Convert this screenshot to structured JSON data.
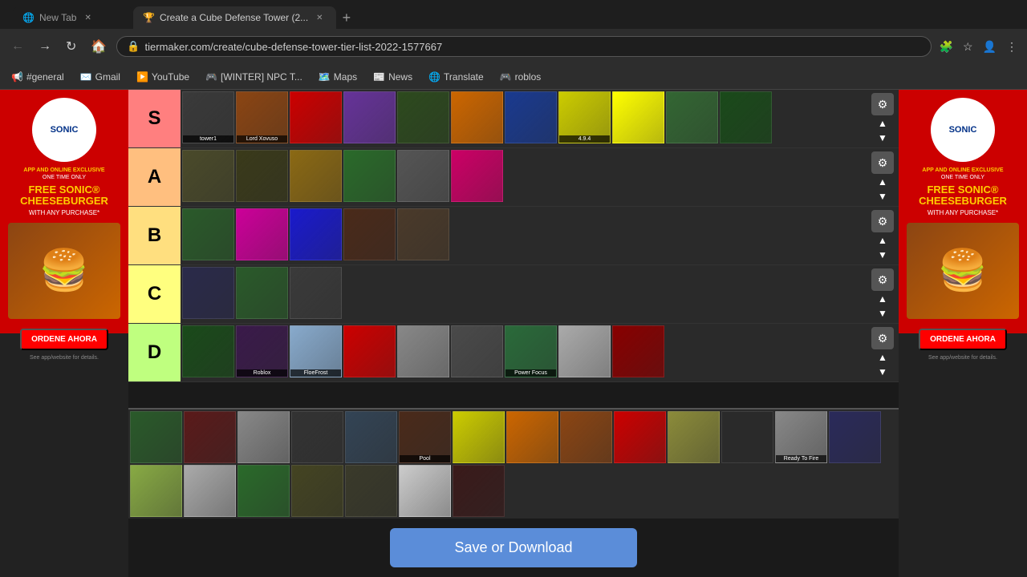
{
  "browser": {
    "tabs": [
      {
        "id": "newtab",
        "label": "New Tab",
        "active": false,
        "favicon": "🌐"
      },
      {
        "id": "tiermaker",
        "label": "Create a Cube Defense Tower (2...",
        "active": true,
        "favicon": "🏆"
      }
    ],
    "url": "tiermaker.com/create/cube-defense-tower-tier-list-2022-1577667",
    "bookmarks": [
      {
        "label": "#general",
        "icon": "📢"
      },
      {
        "label": "Gmail",
        "icon": "✉️"
      },
      {
        "label": "YouTube",
        "icon": "▶️"
      },
      {
        "label": "[WINTER] NPC T...",
        "icon": "🎮"
      },
      {
        "label": "Maps",
        "icon": "🗺️"
      },
      {
        "label": "News",
        "icon": "📰"
      },
      {
        "label": "Translate",
        "icon": "🌐"
      },
      {
        "label": "roblos",
        "icon": "🎮"
      }
    ]
  },
  "tiers": [
    {
      "id": "s",
      "label": "S",
      "color": "#ff7f7f",
      "items": [
        {
          "bg": "#3a3a3a",
          "label": "tower1"
        },
        {
          "bg": "#8B4513",
          "label": "Lord Xovuso"
        },
        {
          "bg": "#cc0000",
          "label": ""
        },
        {
          "bg": "#663399",
          "label": ""
        },
        {
          "bg": "#2d4a1e",
          "label": ""
        },
        {
          "bg": "#cc6600",
          "label": ""
        },
        {
          "bg": "#1a3a8f",
          "label": ""
        },
        {
          "bg": "#cccc00",
          "label": "4.9.4"
        },
        {
          "bg": "#ffff00",
          "label": ""
        },
        {
          "bg": "#336633",
          "label": ""
        },
        {
          "bg": "#1a4a1a",
          "label": ""
        }
      ]
    },
    {
      "id": "a",
      "label": "A",
      "color": "#ffbf7f",
      "items": [
        {
          "bg": "#4a4a2a",
          "label": ""
        },
        {
          "bg": "#3a3a1a",
          "label": ""
        },
        {
          "bg": "#8B6914",
          "label": ""
        },
        {
          "bg": "#2a6a2a",
          "label": ""
        },
        {
          "bg": "#555555",
          "label": ""
        },
        {
          "bg": "#cc0066",
          "label": ""
        }
      ]
    },
    {
      "id": "b",
      "label": "B",
      "color": "#ffdf7f",
      "items": [
        {
          "bg": "#2a5a2a",
          "label": ""
        },
        {
          "bg": "#cc0099",
          "label": ""
        },
        {
          "bg": "#1a1acc",
          "label": ""
        },
        {
          "bg": "#4a2a1a",
          "label": ""
        },
        {
          "bg": "#4a3a2a",
          "label": ""
        }
      ]
    },
    {
      "id": "c",
      "label": "C",
      "color": "#ffff7f",
      "items": [
        {
          "bg": "#2a2a4a",
          "label": ""
        },
        {
          "bg": "#2a5a2a",
          "label": ""
        },
        {
          "bg": "#3a3a3a",
          "label": ""
        }
      ]
    },
    {
      "id": "d",
      "label": "D",
      "color": "#bfff7f",
      "items": [
        {
          "bg": "#1a4a1a",
          "label": ""
        },
        {
          "bg": "#3a1a4a",
          "label": "Roblox"
        },
        {
          "bg": "#88aacc",
          "label": "FloeFrost"
        },
        {
          "bg": "#cc0000",
          "label": ""
        },
        {
          "bg": "#888888",
          "label": ""
        },
        {
          "bg": "#4a4a4a",
          "label": ""
        },
        {
          "bg": "#2a6a3a",
          "label": "Power Focus"
        },
        {
          "bg": "#aaaaaa",
          "label": ""
        },
        {
          "bg": "#880000",
          "label": ""
        }
      ]
    }
  ],
  "pool": {
    "label": "Pool",
    "items": [
      {
        "bg": "#2a5a2a",
        "label": ""
      },
      {
        "bg": "#5a1a1a",
        "label": ""
      },
      {
        "bg": "#888888",
        "label": ""
      },
      {
        "bg": "#333333",
        "label": ""
      },
      {
        "bg": "#334455",
        "label": ""
      },
      {
        "bg": "#4a2a1a",
        "label": "Pool"
      },
      {
        "bg": "#cccc00",
        "label": ""
      },
      {
        "bg": "#cc6600",
        "label": ""
      },
      {
        "bg": "#8B4513",
        "label": ""
      },
      {
        "bg": "#cc0000",
        "label": ""
      },
      {
        "bg": "#8B8B3a",
        "label": ""
      },
      {
        "bg": "#2a2a2a",
        "label": ""
      },
      {
        "bg": "#888888",
        "label": "Ready To Fire"
      },
      {
        "bg": "#2a2a5a",
        "label": ""
      },
      {
        "bg": "#88aa44",
        "label": ""
      },
      {
        "bg": "#aaaaaa",
        "label": ""
      },
      {
        "bg": "#2a6a2a",
        "label": ""
      },
      {
        "bg": "#444422",
        "label": ""
      },
      {
        "bg": "#3a3a2a",
        "label": ""
      },
      {
        "bg": "#cccccc",
        "label": ""
      },
      {
        "bg": "#3a1a1a",
        "label": ""
      }
    ]
  },
  "ad": {
    "logo": "SONIC",
    "tagline1": "APP AND ONLINE EXCLUSIVE",
    "tagline2": "ONE TIME ONLY",
    "offer": "FREE SONIC® CHEESEBURGER",
    "detail": "WITH ANY PURCHASE*",
    "cta": "ORDENE AHORA",
    "fine_print": "See app/website for details."
  },
  "save_button": {
    "label": "Save or Download"
  }
}
